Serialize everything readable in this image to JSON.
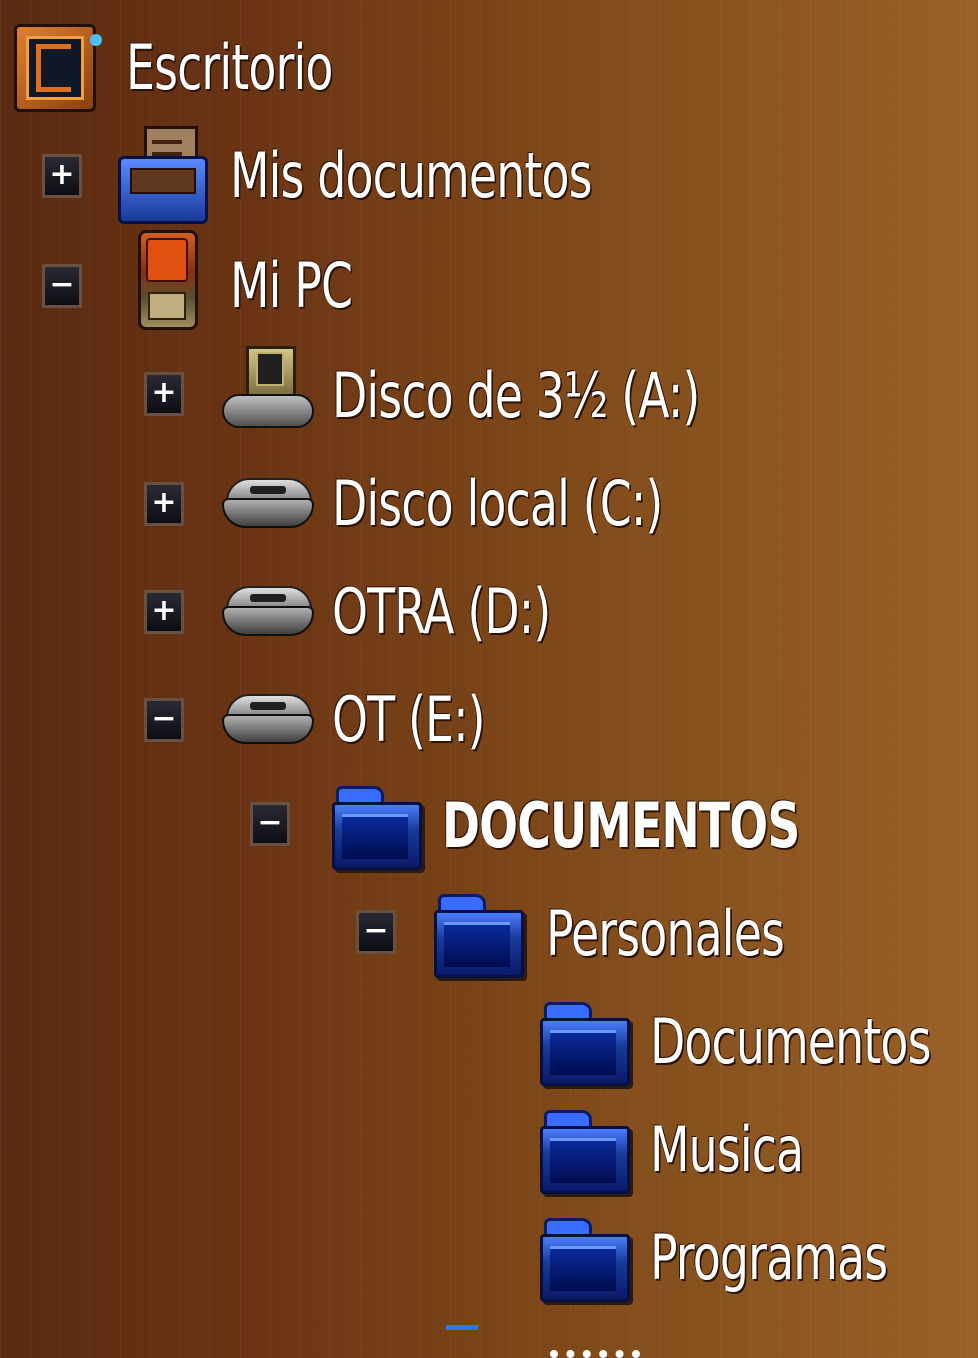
{
  "tree": {
    "root": {
      "label": "Escritorio",
      "icon": "desktop-icon"
    },
    "mis_documentos": {
      "label": "Mis documentos",
      "icon": "my-documents-icon",
      "toggle": "+"
    },
    "mi_pc": {
      "label": "Mi PC",
      "icon": "computer-icon",
      "toggle": "−"
    },
    "disco_a": {
      "label": "Disco de 3½ (A:)",
      "icon": "floppy-drive-icon",
      "toggle": "+"
    },
    "disco_c": {
      "label": "Disco local (C:)",
      "icon": "hard-drive-icon",
      "toggle": "+"
    },
    "disco_d": {
      "label": "OTRA (D:)",
      "icon": "hard-drive-icon",
      "toggle": "+"
    },
    "disco_e": {
      "label": "OT (E:)",
      "icon": "hard-drive-icon",
      "toggle": "−"
    },
    "documentos_folder": {
      "label": "DOCUMENTOS",
      "icon": "folder-icon",
      "toggle": "−"
    },
    "personales": {
      "label": "Personales",
      "icon": "folder-icon",
      "toggle": "−"
    },
    "documentos_sub": {
      "label": "Documentos",
      "icon": "folder-icon"
    },
    "musica": {
      "label": "Musica",
      "icon": "folder-icon"
    },
    "programas": {
      "label": "Programas",
      "icon": "folder-icon"
    }
  },
  "colors": {
    "background_left": "#5a2a12",
    "background_right": "#9a6028",
    "text": "#ffffff",
    "folder_blue": "#1a3a9a"
  }
}
